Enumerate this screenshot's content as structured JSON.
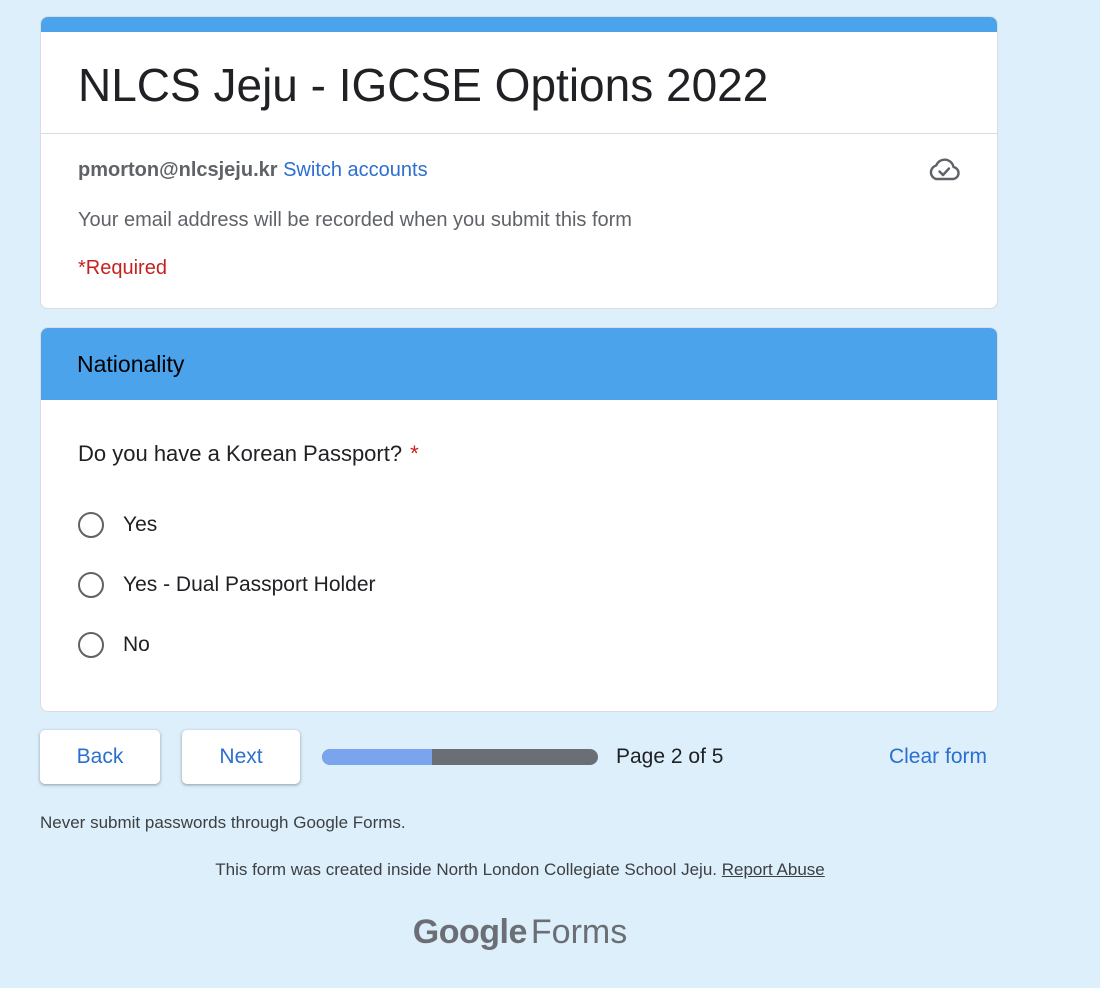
{
  "form": {
    "title": "NLCS Jeju - IGCSE Options 2022",
    "account_email": "pmorton@nlcsjeju.kr",
    "switch_accounts": "Switch accounts",
    "email_note": "Your email address will be recorded when you submit this form",
    "required_note": "*Required"
  },
  "section": {
    "title": "Nationality"
  },
  "question": {
    "text": "Do you have a Korean Passport?",
    "required_mark": "*",
    "options": [
      {
        "label": "Yes",
        "selected": false
      },
      {
        "label": "Yes - Dual Passport Holder",
        "selected": false
      },
      {
        "label": "No",
        "selected": false
      }
    ]
  },
  "navigation": {
    "back_label": "Back",
    "next_label": "Next",
    "page_indicator": "Page 2 of 5",
    "current_page": 2,
    "total_pages": 5,
    "clear_label": "Clear form"
  },
  "footer": {
    "password_warning": "Never submit passwords through Google Forms.",
    "created_inside": "This form was created inside North London Collegiate School Jeju.",
    "report_abuse": "Report Abuse",
    "brand_google": "Google",
    "brand_forms": "Forms"
  },
  "icons": {
    "cloud": "cloud-check-icon"
  },
  "colors": {
    "accent": "#4ba3eb",
    "link": "#2b6fcf",
    "required": "#c5221f",
    "background": "#ddeffb",
    "progress_fill": "#7aa4ee",
    "progress_track": "#6b6f75"
  }
}
